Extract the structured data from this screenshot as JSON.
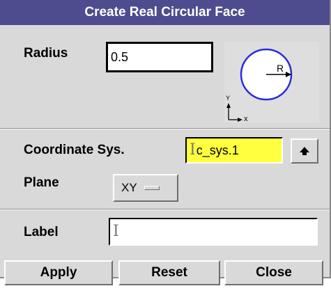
{
  "dialog": {
    "title": "Create Real Circular Face"
  },
  "radius": {
    "label": "Radius",
    "value": "0.5"
  },
  "diagram": {
    "radius_label": "R",
    "axis_y": "Y",
    "axis_x": "x"
  },
  "coordinate_sys": {
    "label": "Coordinate Sys.",
    "value": "c_sys.1"
  },
  "plane": {
    "label": "Plane",
    "value": "XY"
  },
  "label_field": {
    "label": "Label",
    "value": ""
  },
  "buttons": {
    "apply": "Apply",
    "reset": "Reset",
    "close": "Close"
  },
  "colors": {
    "title_bar": "#4e4b8f",
    "highlight_field": "#ffff40",
    "circle": "#2a2ae0"
  }
}
